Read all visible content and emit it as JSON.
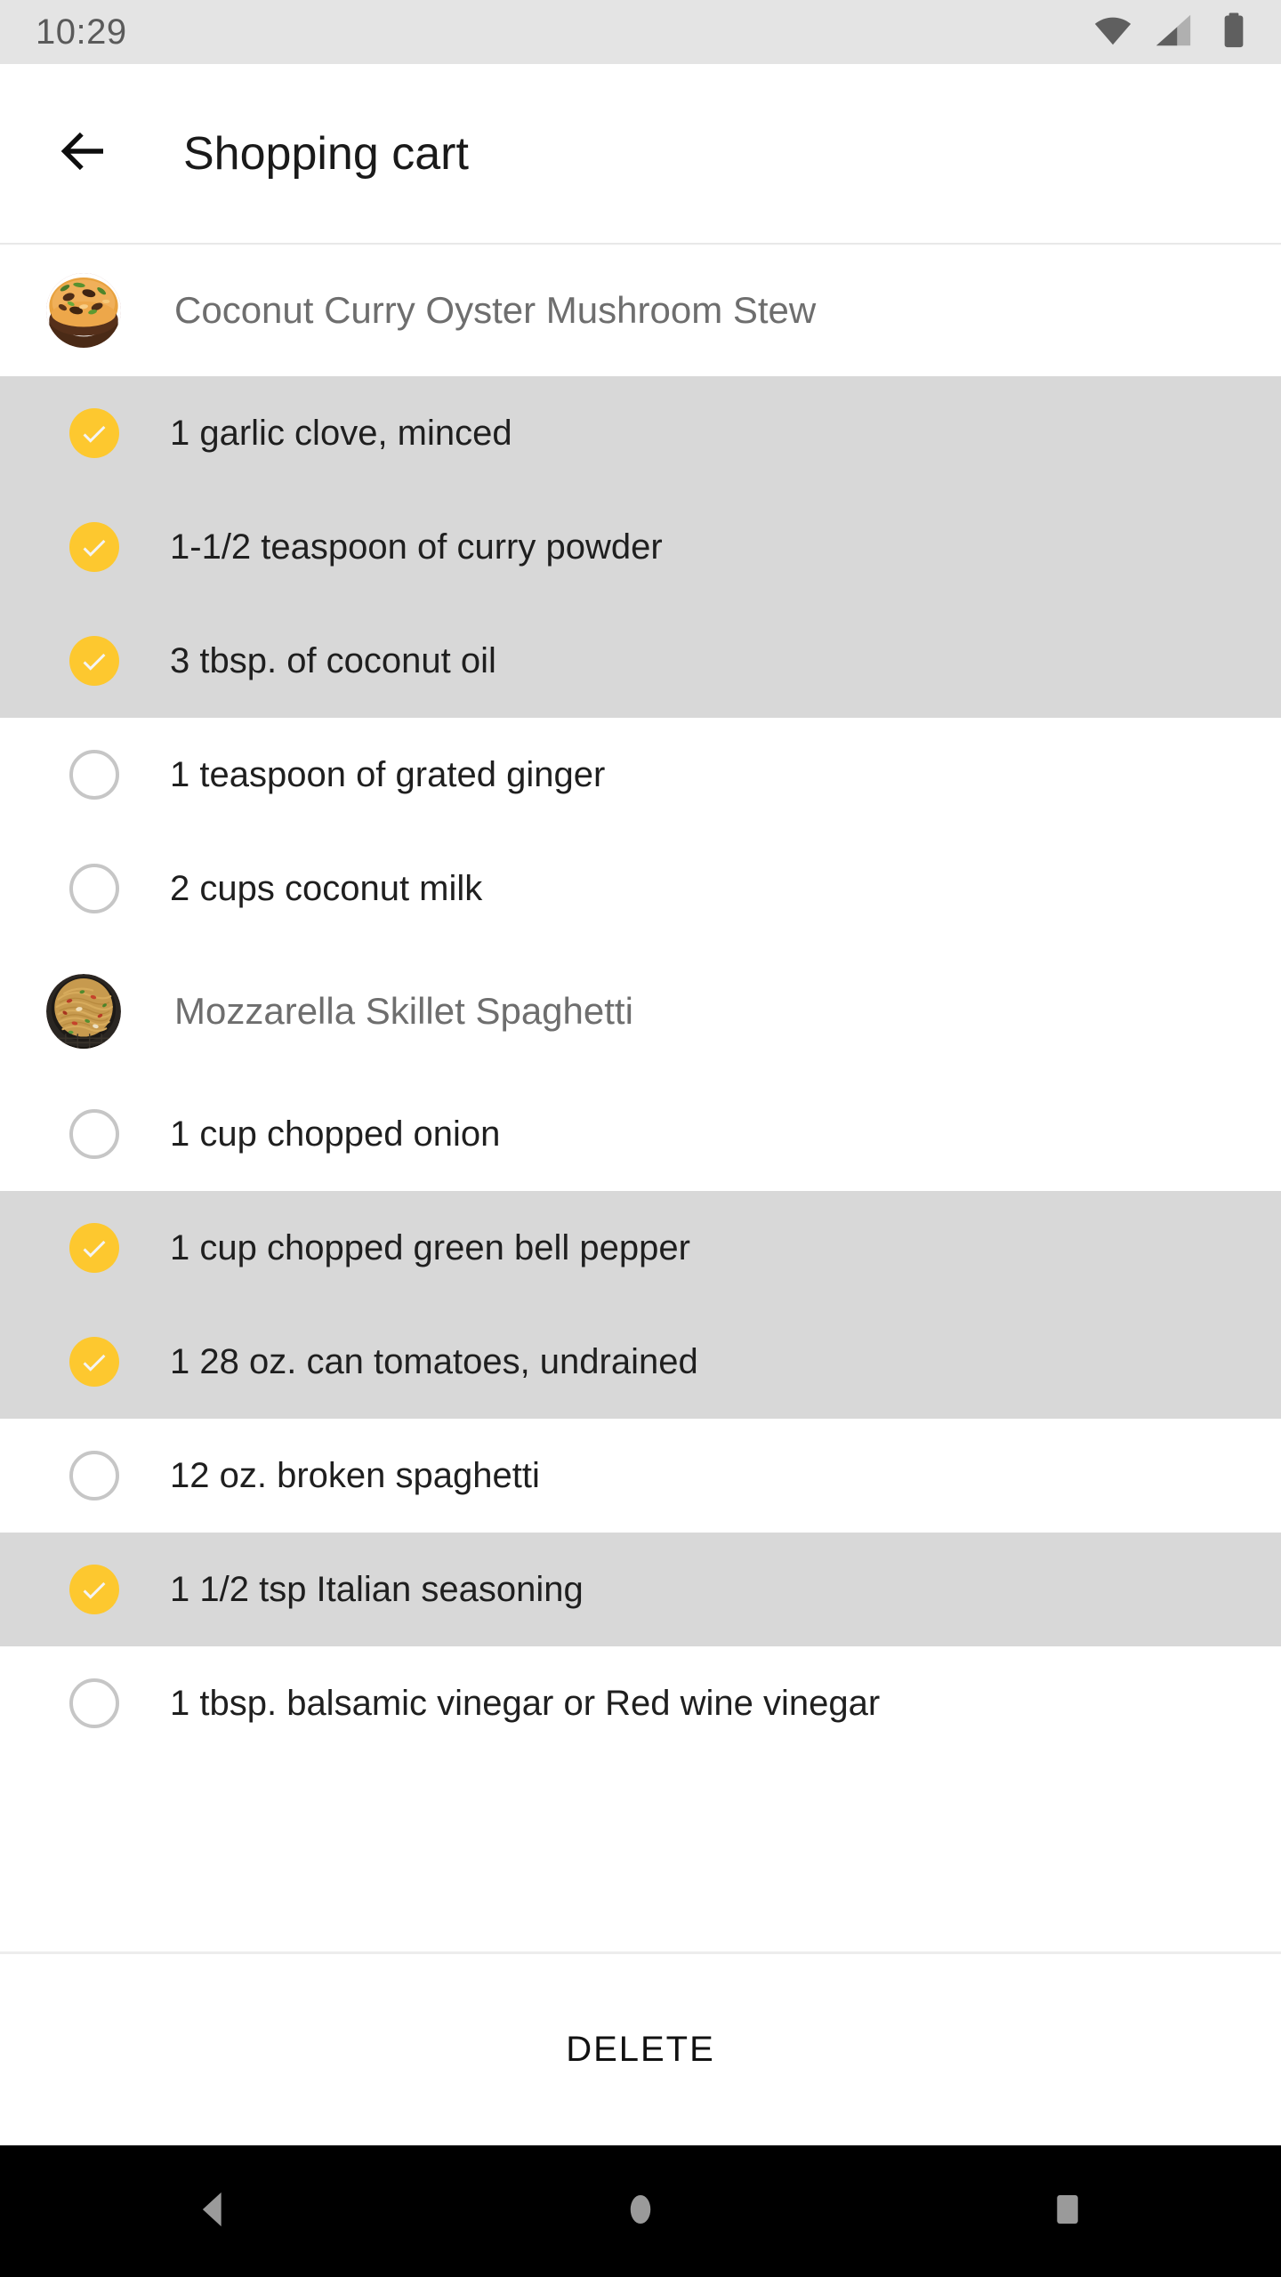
{
  "status_bar": {
    "time": "10:29",
    "icons": [
      {
        "name": "wifi-icon",
        "label": "wifi"
      },
      {
        "name": "cellular-signal-icon",
        "label": "cellular signal"
      },
      {
        "name": "battery-icon",
        "label": "battery full"
      }
    ],
    "background_color": "#e4e4e4",
    "text_color": "#5a5a5a"
  },
  "app_bar": {
    "back_icon": "back-arrow-icon",
    "title": "Shopping cart",
    "background_color": "#ffffff",
    "title_color": "#1a1a1a"
  },
  "colors": {
    "accent": "#fdc82f",
    "checked_row_bg": "#d8d8d8",
    "unchecked_row_bg": "#ffffff",
    "checkbox_outline": "#c6c6c6",
    "recipe_title": "#6e6e6e",
    "ingredient_text": "#1f1f1f",
    "nav_bar_bg": "#000000",
    "nav_icon": "#9a9a9a"
  },
  "recipes": [
    {
      "title": "Coconut Curry Oyster Mushroom Stew",
      "thumbnail": "coconut-curry-stew-thumbnail",
      "ingredients": [
        {
          "label": "1 garlic clove, minced",
          "checked": true
        },
        {
          "label": "1-1/2 teaspoon of curry powder",
          "checked": true
        },
        {
          "label": "3 tbsp. of coconut oil",
          "checked": true
        },
        {
          "label": "1 teaspoon of grated ginger",
          "checked": false
        },
        {
          "label": "2 cups coconut milk",
          "checked": false
        }
      ]
    },
    {
      "title": "Mozzarella Skillet Spaghetti",
      "thumbnail": "mozzarella-skillet-spaghetti-thumbnail",
      "ingredients": [
        {
          "label": "1 cup chopped onion",
          "checked": false
        },
        {
          "label": "1 cup chopped green bell pepper",
          "checked": true
        },
        {
          "label": "1 28 oz. can tomatoes, undrained",
          "checked": true
        },
        {
          "label": "12 oz. broken spaghetti",
          "checked": false
        },
        {
          "label": "1 1/2 tsp Italian seasoning",
          "checked": true
        },
        {
          "label": "1 tbsp. balsamic vinegar or Red wine vinegar",
          "checked": false
        }
      ]
    }
  ],
  "footer": {
    "delete_label": "DELETE"
  },
  "nav_bar": {
    "buttons": [
      {
        "name": "nav-back-button",
        "icon": "triangle-back-icon"
      },
      {
        "name": "nav-home-button",
        "icon": "circle-home-icon"
      },
      {
        "name": "nav-recents-button",
        "icon": "square-recents-icon"
      }
    ]
  }
}
